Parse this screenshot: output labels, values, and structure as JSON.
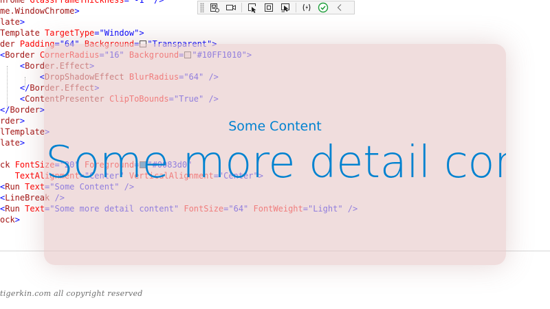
{
  "editor": {
    "lines": [
      [
        {
          "t": "hrome ",
          "c": "e"
        },
        {
          "t": "GlassFrameThickness",
          "c": "a"
        },
        {
          "t": "=\"-1\"",
          "c": "v"
        },
        {
          "t": " />",
          "c": "p"
        }
      ],
      [
        {
          "t": "me.WindowChrome",
          "c": "e"
        },
        {
          "t": ">",
          "c": "p"
        }
      ],
      [
        {
          "t": "late",
          "c": "e"
        },
        {
          "t": ">",
          "c": "p"
        }
      ],
      [
        {
          "t": "Template ",
          "c": "e"
        },
        {
          "t": "TargetType",
          "c": "a"
        },
        {
          "t": "=\"Window\"",
          "c": "v"
        },
        {
          "t": ">",
          "c": "p"
        }
      ],
      [
        {
          "t": "der ",
          "c": "e"
        },
        {
          "t": "Padding",
          "c": "a"
        },
        {
          "t": "=\"64\" ",
          "c": "v"
        },
        {
          "t": "Background",
          "c": "a"
        },
        {
          "t": "=",
          "c": "v"
        },
        {
          "sw": "#ffffff"
        },
        {
          "t": "\"Transparent\"",
          "c": "v"
        },
        {
          "t": ">",
          "c": "p"
        }
      ],
      [
        {
          "t": "<",
          "c": "p"
        },
        {
          "t": "Border ",
          "c": "e"
        },
        {
          "t": "CornerRadius",
          "c": "a"
        },
        {
          "t": "=\"16\" ",
          "c": "v"
        },
        {
          "t": "Background",
          "c": "a"
        },
        {
          "t": "=",
          "c": "v"
        },
        {
          "sw": "#f7eded"
        },
        {
          "t": "\"#10FF1010\"",
          "c": "v"
        },
        {
          "t": ">",
          "c": "p"
        }
      ],
      [
        {
          "t": "    <",
          "c": "p"
        },
        {
          "t": "Border.Effect",
          "c": "e"
        },
        {
          "t": ">",
          "c": "p"
        }
      ],
      [
        {
          "t": "        <",
          "c": "p"
        },
        {
          "t": "DropShadowEffect ",
          "c": "e"
        },
        {
          "t": "BlurRadius",
          "c": "a"
        },
        {
          "t": "=\"64\"",
          "c": "v"
        },
        {
          "t": " />",
          "c": "p"
        }
      ],
      [
        {
          "t": "    </",
          "c": "p"
        },
        {
          "t": "Border.Effect",
          "c": "e"
        },
        {
          "t": ">",
          "c": "p"
        }
      ],
      [
        {
          "t": "    <",
          "c": "p"
        },
        {
          "t": "ContentPresenter ",
          "c": "e"
        },
        {
          "t": "ClipToBounds",
          "c": "a"
        },
        {
          "t": "=\"True\"",
          "c": "v"
        },
        {
          "t": " />",
          "c": "p"
        }
      ],
      [
        {
          "t": "</",
          "c": "p"
        },
        {
          "t": "Border",
          "c": "e"
        },
        {
          "t": ">",
          "c": "p"
        }
      ],
      [
        {
          "t": "rder",
          "c": "e"
        },
        {
          "t": ">",
          "c": "p"
        }
      ],
      [
        {
          "t": "lTemplate",
          "c": "e"
        },
        {
          "t": ">",
          "c": "p"
        }
      ],
      [
        {
          "t": "late",
          "c": "e"
        },
        {
          "t": ">",
          "c": "p"
        }
      ],
      [],
      [
        {
          "t": "ck ",
          "c": "e"
        },
        {
          "t": "FontSize",
          "c": "a"
        },
        {
          "t": "=\"20\" ",
          "c": "v"
        },
        {
          "t": "Foreground",
          "c": "a"
        },
        {
          "t": "=",
          "c": "v"
        },
        {
          "sw": "#0083d0"
        },
        {
          "t": "\"#0083d0\"",
          "c": "v"
        }
      ],
      [
        {
          "t": "   ",
          "c": "p"
        },
        {
          "t": "TextAlignment",
          "c": "a"
        },
        {
          "t": "=\"Center\" ",
          "c": "v"
        },
        {
          "t": "VerticalAlignment",
          "c": "a"
        },
        {
          "t": "=\"Center\"",
          "c": "v"
        },
        {
          "t": ">",
          "c": "p"
        }
      ],
      [
        {
          "t": "<",
          "c": "p"
        },
        {
          "t": "Run ",
          "c": "e"
        },
        {
          "t": "Text",
          "c": "a"
        },
        {
          "t": "=\"Some Content\"",
          "c": "v"
        },
        {
          "t": " />",
          "c": "p"
        }
      ],
      [
        {
          "t": "<",
          "c": "p"
        },
        {
          "t": "LineBreak",
          "c": "e"
        },
        {
          "t": " />",
          "c": "p"
        }
      ],
      [
        {
          "t": "<",
          "c": "p"
        },
        {
          "t": "Run ",
          "c": "e"
        },
        {
          "t": "Text",
          "c": "a"
        },
        {
          "t": "=\"Some more detail content\" ",
          "c": "v"
        },
        {
          "t": "FontSize",
          "c": "a"
        },
        {
          "t": "=\"64\" ",
          "c": "v"
        },
        {
          "t": "FontWeight",
          "c": "a"
        },
        {
          "t": "=\"Light\"",
          "c": "v"
        },
        {
          "t": " />",
          "c": "p"
        }
      ],
      [
        {
          "t": "ock",
          "c": "e"
        },
        {
          "t": ">",
          "c": "p"
        }
      ]
    ],
    "watermark": "tigerkin.com all copyright reserved"
  },
  "toolbar": {
    "buttons": [
      {
        "name": "device-preview-icon"
      },
      {
        "name": "record-camera-icon"
      },
      {
        "name": "select-element-icon"
      },
      {
        "name": "display-layout-adorners-icon"
      },
      {
        "name": "track-focused-element-icon"
      },
      {
        "name": "hot-reload-icon"
      },
      {
        "name": "hot-reload-status-check-icon"
      },
      {
        "name": "collapse-toolbar-icon"
      }
    ]
  },
  "window": {
    "small_run": "Some Content",
    "large_run": "Some more detail content",
    "background": "#10FF1010",
    "foreground": "#0083d0"
  }
}
